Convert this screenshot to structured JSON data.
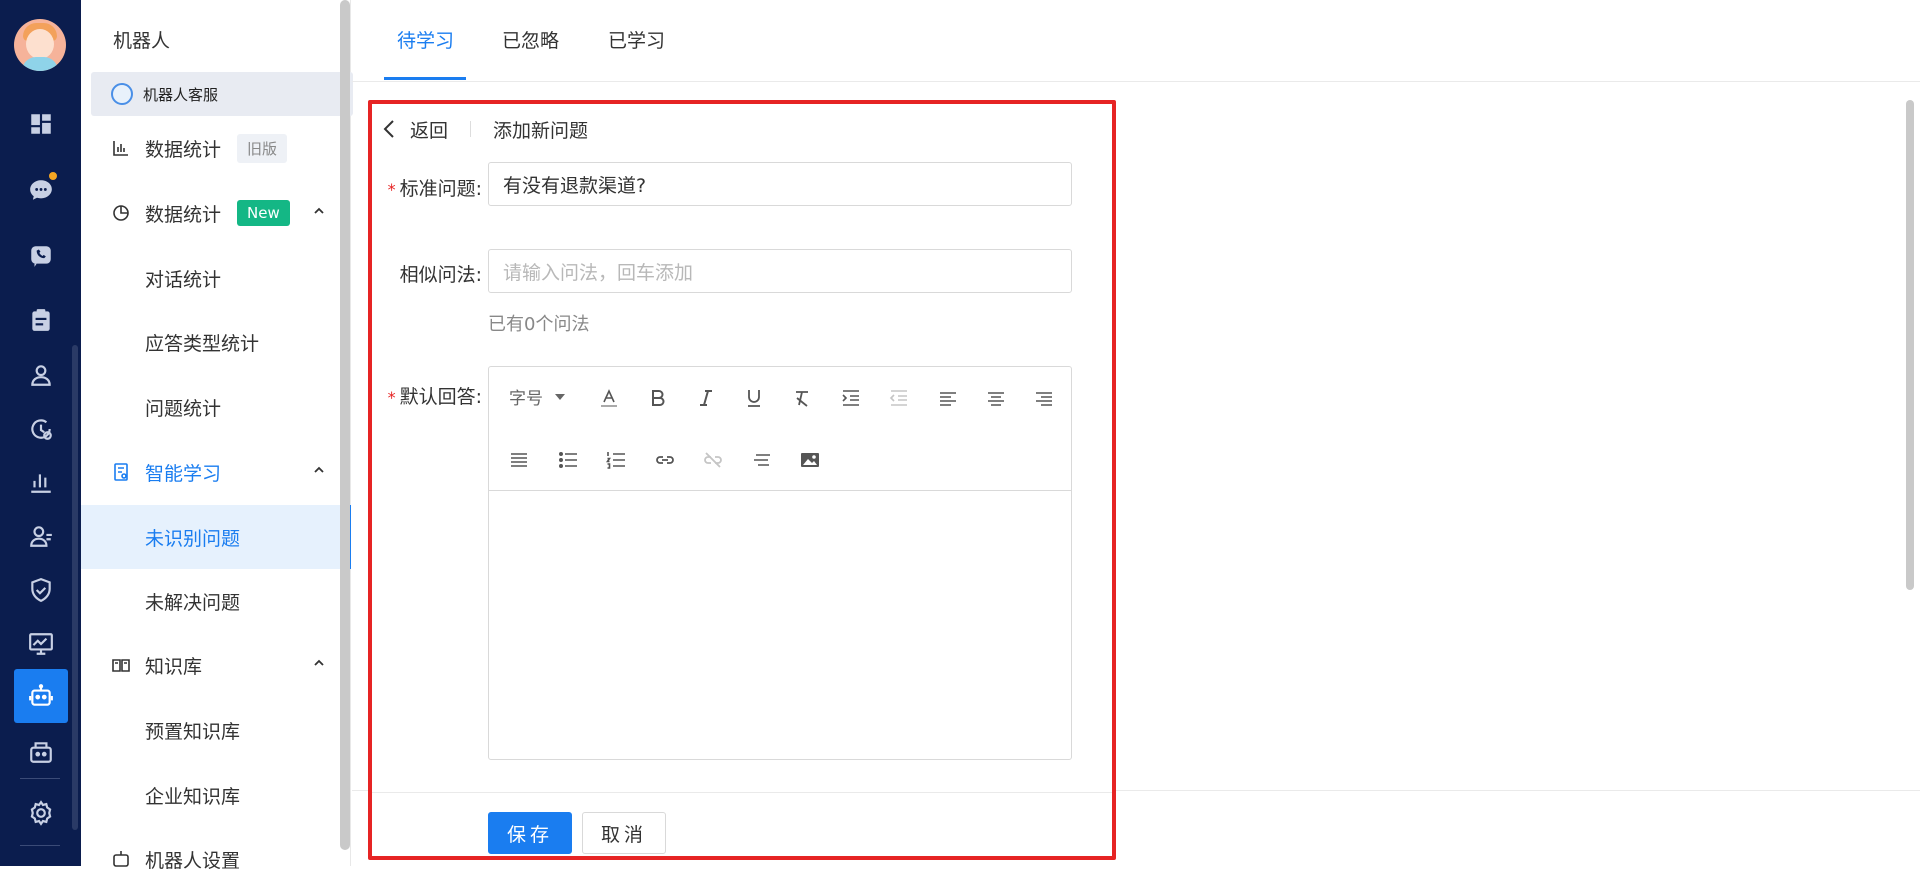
{
  "colors": {
    "rail_bg": "#0b1d4e",
    "primary": "#1a7df0",
    "required": "#e62424",
    "tag_new": "#14b785",
    "highlight_border": "#e62424"
  },
  "rail": {
    "icons": [
      "dashboard-icon",
      "chat-icon",
      "phone-icon",
      "clipboard-icon",
      "user-icon",
      "history-icon",
      "bar-chart-icon",
      "team-icon",
      "shield-icon",
      "monitor-icon",
      "robot-icon",
      "mailbox-icon",
      "settings-icon"
    ],
    "active": "robot-icon"
  },
  "menu": {
    "title": "机器人",
    "robot_name": "机器人客服",
    "items": [
      {
        "label": "数据统计",
        "tag": "旧版",
        "icon": "bar-chart-icon"
      },
      {
        "label": "数据统计",
        "tag": "New",
        "icon": "pie-chart-icon",
        "expanded": true
      },
      {
        "label": "对话统计"
      },
      {
        "label": "应答类型统计"
      },
      {
        "label": "问题统计"
      },
      {
        "label": "智能学习",
        "icon": "learn-icon",
        "expanded": true
      },
      {
        "label": "未识别问题",
        "selected": true
      },
      {
        "label": "未解决问题"
      },
      {
        "label": "知识库",
        "icon": "book-icon",
        "expanded": true
      },
      {
        "label": "预置知识库"
      },
      {
        "label": "企业知识库"
      },
      {
        "label": "机器人设置",
        "icon": "robot-icon"
      }
    ]
  },
  "tabs": [
    {
      "label": "待学习",
      "active": true
    },
    {
      "label": "已忽略"
    },
    {
      "label": "已学习"
    }
  ],
  "form": {
    "back_label": "返回",
    "header_title": "添加新问题",
    "standard_question": {
      "label": "标准问题:",
      "required": true,
      "value": "有没有退款渠道?"
    },
    "similar_question": {
      "label": "相似问法:",
      "placeholder": "请输入问法，回车添加",
      "hint": "已有0个问法"
    },
    "default_answer": {
      "label": "默认回答:",
      "required": true,
      "font_size_label": "字号",
      "value": ""
    },
    "save_label": "保存",
    "cancel_label": "取消"
  }
}
